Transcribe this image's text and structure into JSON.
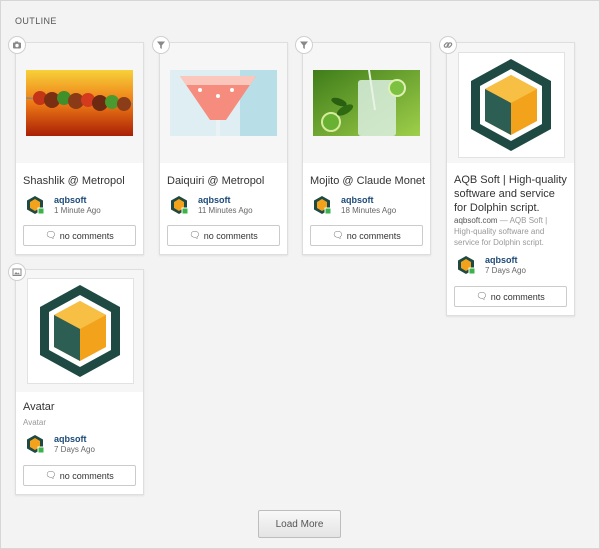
{
  "section": {
    "title": "OUTLINE"
  },
  "cards": [
    {
      "type_icon": "camera-icon",
      "title": "Shashlik @ Metropol",
      "author": "aqbsoft",
      "time": "1 Minute Ago",
      "comments": "no comments"
    },
    {
      "type_icon": "filter-icon",
      "title": "Daiquiri  @ Metropol",
      "author": "aqbsoft",
      "time": "11 Minutes Ago",
      "comments": "no comments"
    },
    {
      "type_icon": "filter-icon",
      "title": "Mojito @ Claude Monet",
      "author": "aqbsoft",
      "time": "18 Minutes Ago",
      "comments": "no comments"
    },
    {
      "type_icon": "link-icon",
      "title_lines": [
        "AQB Soft | High-quality",
        "software and service",
        "for Dolphin script."
      ],
      "source_domain": "aqbsoft.com",
      "source_lines": [
        " — AQB Soft |",
        "High-quality software and",
        "service for Dolphin script."
      ],
      "author": "aqbsoft",
      "time": "7 Days Ago",
      "comments": "no comments"
    },
    {
      "type_icon": "image-icon",
      "title": "Avatar",
      "subtitle": "Avatar",
      "author": "aqbsoft",
      "time": "7 Days Ago",
      "comments": "no comments"
    }
  ],
  "load_more": "Load More",
  "colors": {
    "author_link": "#1c4a78",
    "logo_dark": "#1f4a43",
    "logo_orange": "#f3a21c",
    "online_dot": "#3bb34a"
  }
}
